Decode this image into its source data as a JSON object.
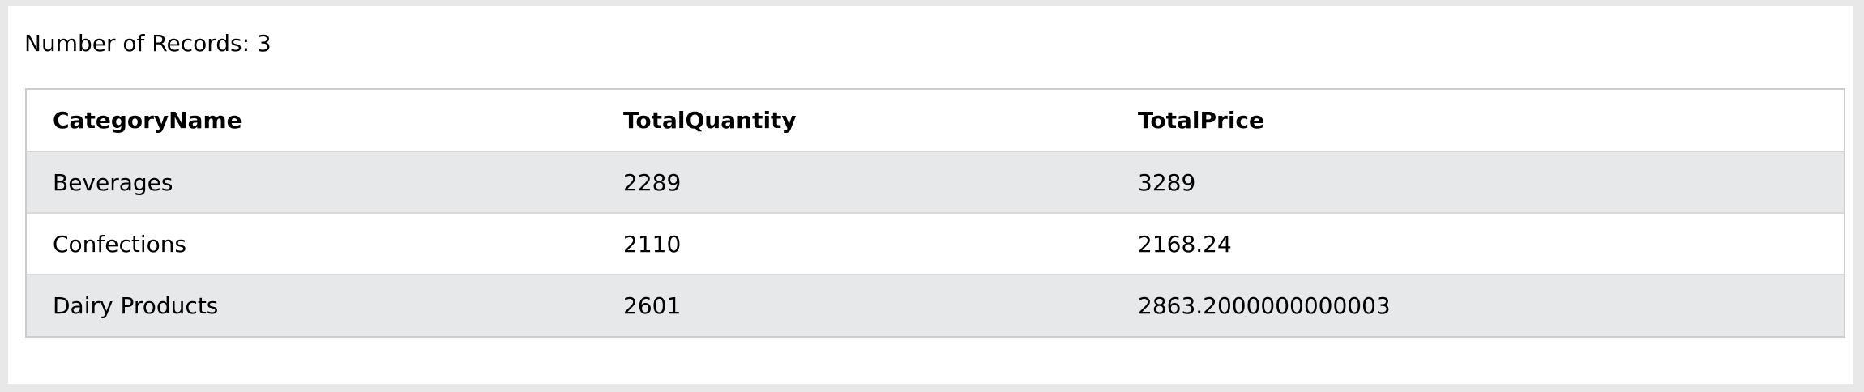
{
  "summary": {
    "label": "Number of Records: 3"
  },
  "table": {
    "columns": [
      "CategoryName",
      "TotalQuantity",
      "TotalPrice"
    ],
    "rows": [
      [
        "Beverages",
        "2289",
        "3289"
      ],
      [
        "Confections",
        "2110",
        "2168.24"
      ],
      [
        "Dairy Products",
        "2601",
        "2863.2000000000003"
      ]
    ]
  }
}
